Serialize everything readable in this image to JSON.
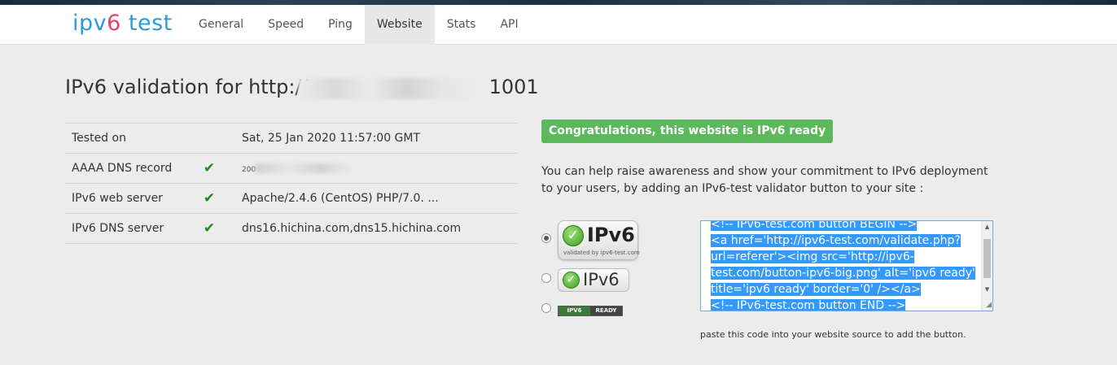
{
  "brand": {
    "part1": "ipv",
    "part2": "6",
    "part3": " test"
  },
  "nav": {
    "items": [
      {
        "label": "General"
      },
      {
        "label": "Speed"
      },
      {
        "label": "Ping"
      },
      {
        "label": "Website",
        "active": true
      },
      {
        "label": "Stats"
      },
      {
        "label": "API"
      }
    ]
  },
  "page": {
    "title_prefix": "IPv6 validation for http://",
    "title_suffix": "1001"
  },
  "results": {
    "rows": [
      {
        "label": "Tested on",
        "check": false,
        "value": "Sat, 25 Jan 2020 11:57:00 GMT"
      },
      {
        "label": "AAAA DNS record",
        "check": true,
        "value": "200"
      },
      {
        "label": "IPv6 web server",
        "check": true,
        "value": "Apache/2.4.6 (CentOS) PHP/7.0. ..."
      },
      {
        "label": "IPv6 DNS server",
        "check": true,
        "value": "dns16.hichina.com,dns15.hichina.com"
      }
    ],
    "check_glyph": "✔"
  },
  "success": {
    "text": "Congratulations, this website is IPv6 ready",
    "color": "#5cb85c"
  },
  "intro": {
    "text": "You can help raise awareness and show your commitment to IPv6 deployment to your users, by adding an IPv6-test validator button to your site :"
  },
  "buttons": {
    "big": {
      "text": "IPv6",
      "sub": "validated by ipv6-test.com",
      "selected": true
    },
    "mid": {
      "text": "IPv6",
      "selected": false
    },
    "small": {
      "left": "IPV6",
      "right": "READY",
      "selected": false
    }
  },
  "code": {
    "lines": [
      "<!-- IPv6-test.com button BEGIN -->",
      "<a href='http://ipv6-test.com/validate.php?",
      "url=referer'><img src='http://ipv6-",
      "test.com/button-ipv6-big.png' alt='ipv6 ready'",
      "title='ipv6 ready' border='0' /></a>",
      "<!-- IPv6-test.com button END -->"
    ],
    "hint": "paste this code into your website source to add the button."
  },
  "icons": {
    "check": "checkmark-icon",
    "scroll_up": "triangle-up",
    "scroll_down": "triangle-down",
    "resize": "resize-grip-icon"
  }
}
